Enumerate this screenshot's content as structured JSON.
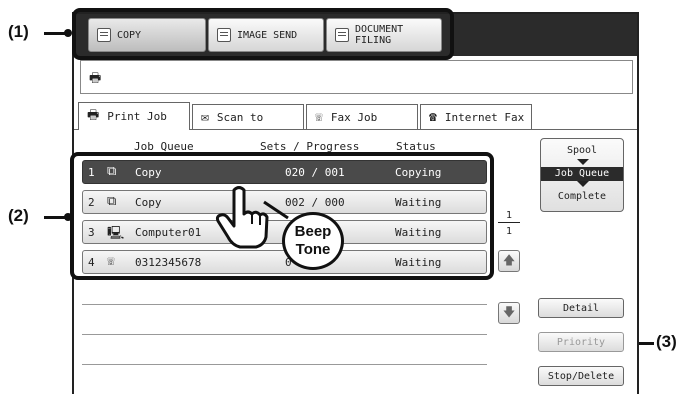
{
  "callouts": {
    "one": "(1)",
    "two": "(2)",
    "three": "(3)"
  },
  "modes": [
    {
      "label": "COPY",
      "icon": "copy-icon"
    },
    {
      "label": "IMAGE SEND",
      "icon": "image-send-icon"
    },
    {
      "label": "DOCUMENT\nFILING",
      "icon": "document-filing-icon"
    }
  ],
  "tabs": [
    {
      "label": "Print Job",
      "icon": "printer-icon"
    },
    {
      "label": "Scan to",
      "icon": "scan-icon"
    },
    {
      "label": "Fax Job",
      "icon": "fax-icon"
    },
    {
      "label": "Internet Fax",
      "icon": "internet-fax-icon"
    }
  ],
  "columns": {
    "queue": "Job Queue",
    "progress": "Sets / Progress",
    "status": "Status"
  },
  "jobs": [
    {
      "num": "1",
      "name": "Copy",
      "progress": "020 / 001",
      "status": "Copying",
      "icon": "copy-icon"
    },
    {
      "num": "2",
      "name": "Copy",
      "progress": "002 / 000",
      "status": "Waiting",
      "icon": "copy-icon"
    },
    {
      "num": "3",
      "name": "Computer01",
      "progress": "",
      "status": "Waiting",
      "icon": "computer-icon"
    },
    {
      "num": "4",
      "name": "0312345678",
      "progress": "0",
      "status": "Waiting",
      "icon": "fax-icon"
    }
  ],
  "spool": {
    "spool": "Spool",
    "queue": "Job Queue",
    "complete": "Complete"
  },
  "pagination": {
    "current": "1",
    "total": "1"
  },
  "buttons": {
    "detail": "Detail",
    "priority": "Priority",
    "stop_delete": "Stop/Delete"
  },
  "beep": {
    "line1": "Beep",
    "line2": "Tone"
  }
}
